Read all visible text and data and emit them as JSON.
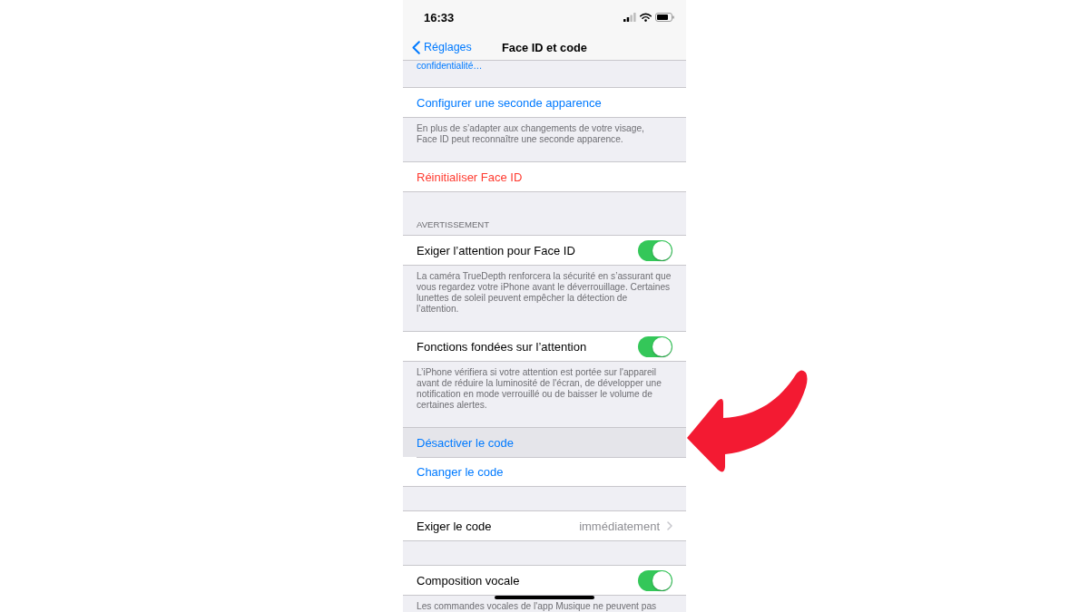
{
  "status_bar": {
    "time": "16:33"
  },
  "nav_bar": {
    "back_label": "Réglages",
    "title": "Face ID et code"
  },
  "sections": [
    {
      "footer": {
        "kind": "link",
        "text": "confidentialité…"
      }
    },
    {
      "rows": [
        {
          "kind": "action",
          "label": "Configurer une seconde apparence",
          "selected": false
        }
      ],
      "footer": {
        "kind": "note",
        "text": "En plus de s’adapter aux changements de votre visage,\nFace ID peut reconnaître une seconde apparence."
      }
    },
    {
      "rows": [
        {
          "kind": "destructive",
          "label": "Réinitialiser Face ID",
          "selected": false
        }
      ]
    },
    {
      "header": "AVERTISSEMENT",
      "rows": [
        {
          "kind": "toggle",
          "label": "Exiger l’attention pour Face ID",
          "on": true,
          "selected": false
        }
      ],
      "footer": {
        "kind": "note",
        "text": "La caméra TrueDepth renforcera la sécurité en s’assurant que\nvous regardez votre iPhone avant le déverrouillage. Certaines\nlunettes de soleil peuvent empêcher la détection de\nl’attention."
      }
    },
    {
      "rows": [
        {
          "kind": "toggle",
          "label": "Fonctions fondées sur l’attention",
          "on": true,
          "selected": false
        }
      ],
      "footer": {
        "kind": "note",
        "text": "L’iPhone vérifiera si votre attention est portée sur l'appareil\navant de réduire la luminosité de l'écran, de développer une\nnotification en mode verrouillé ou de baisser le volume de\ncertaines alertes."
      }
    },
    {
      "rows": [
        {
          "kind": "action",
          "label": "Désactiver le code",
          "selected": true
        },
        {
          "kind": "action",
          "label": "Changer le code",
          "selected": false
        }
      ]
    },
    {
      "rows": [
        {
          "kind": "detail",
          "label": "Exiger le code",
          "value": "immédiatement",
          "selected": false
        }
      ]
    },
    {
      "rows": [
        {
          "kind": "toggle",
          "label": "Composition vocale",
          "on": true,
          "selected": false
        }
      ],
      "footer": {
        "kind": "note",
        "text": "Les commandes vocales de l'app Musique ne peuvent pas"
      }
    }
  ]
}
